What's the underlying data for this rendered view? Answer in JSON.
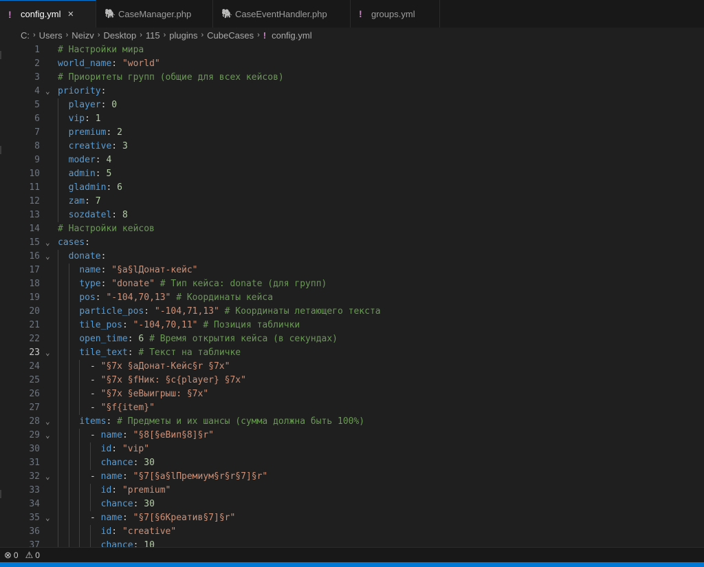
{
  "tabs": [
    {
      "label": "config.yml",
      "icon": "yaml-icon",
      "active": true
    },
    {
      "label": "CaseManager.php",
      "icon": "php-icon",
      "active": false
    },
    {
      "label": "CaseEventHandler.php",
      "icon": "php-icon",
      "active": false
    },
    {
      "label": "groups.yml",
      "icon": "yaml-icon",
      "active": false
    }
  ],
  "breadcrumb": [
    "C:",
    "Users",
    "Neizv",
    "Desktop",
    "115",
    "plugins",
    "CubeCases",
    "config.yml"
  ],
  "editor": {
    "current_line": 23,
    "lines": [
      {
        "num": "1",
        "text": "# Настройки мира"
      },
      {
        "num": "2",
        "text": "world_name: \"world\""
      },
      {
        "num": "3",
        "text": "# Приоритеты групп (общие для всех кейсов)"
      },
      {
        "num": "4",
        "text": "priority:"
      },
      {
        "num": "5",
        "text": "  player: 0"
      },
      {
        "num": "6",
        "text": "  vip: 1"
      },
      {
        "num": "7",
        "text": "  premium: 2"
      },
      {
        "num": "8",
        "text": "  creative: 3"
      },
      {
        "num": "9",
        "text": "  moder: 4"
      },
      {
        "num": "10",
        "text": "  admin: 5"
      },
      {
        "num": "11",
        "text": "  gladmin: 6"
      },
      {
        "num": "12",
        "text": "  zam: 7"
      },
      {
        "num": "13",
        "text": "  sozdatel: 8"
      },
      {
        "num": "14",
        "text": "# Настройки кейсов"
      },
      {
        "num": "15",
        "text": "cases:"
      },
      {
        "num": "16",
        "text": "  donate:"
      },
      {
        "num": "17",
        "text": "    name: \"§a§lДонат-кейс\""
      },
      {
        "num": "18",
        "text": "    type: \"donate\" # Тип кейса: donate (для групп)"
      },
      {
        "num": "19",
        "text": "    pos: \"-104,70,13\" # Координаты кейса"
      },
      {
        "num": "20",
        "text": "    particle_pos: \"-104,71,13\" # Координаты летающего текста"
      },
      {
        "num": "21",
        "text": "    tile_pos: \"-104,70,11\" # Позиция таблички"
      },
      {
        "num": "22",
        "text": "    open_time: 6 # Время открытия кейса (в секундах)"
      },
      {
        "num": "23",
        "text": "    tile_text: # Текст на табличке"
      },
      {
        "num": "24",
        "text": "      - \"§7x §aДонат-Кейс§r §7x\""
      },
      {
        "num": "25",
        "text": "      - \"§7x §fНик: §c{player} §7x\""
      },
      {
        "num": "26",
        "text": "      - \"§7x §eВыигрыш: §7x\""
      },
      {
        "num": "27",
        "text": "      - \"§f{item}\""
      },
      {
        "num": "28",
        "text": "    items: # Предметы и их шансы (сумма должна быть 100%)"
      },
      {
        "num": "29",
        "text": "      - name: \"§8[§eВип§8]§r\""
      },
      {
        "num": "30",
        "text": "        id: \"vip\""
      },
      {
        "num": "31",
        "text": "        chance: 30"
      },
      {
        "num": "32",
        "text": "      - name: \"§7[§a§lПремиум§r§r§7]§r\""
      },
      {
        "num": "33",
        "text": "        id: \"premium\""
      },
      {
        "num": "34",
        "text": "        chance: 30"
      },
      {
        "num": "35",
        "text": "      - name: \"§7[§6Креатив§7]§r\""
      },
      {
        "num": "36",
        "text": "        id: \"creative\""
      },
      {
        "num": "37",
        "text": "        chance: 10"
      }
    ]
  },
  "status": {
    "errors": "0",
    "warnings": "0"
  },
  "colors": {
    "key": "#569cd6",
    "string": "#ce9178",
    "number": "#b5cea8",
    "comment": "#6a9955",
    "accent": "#0078d4"
  }
}
